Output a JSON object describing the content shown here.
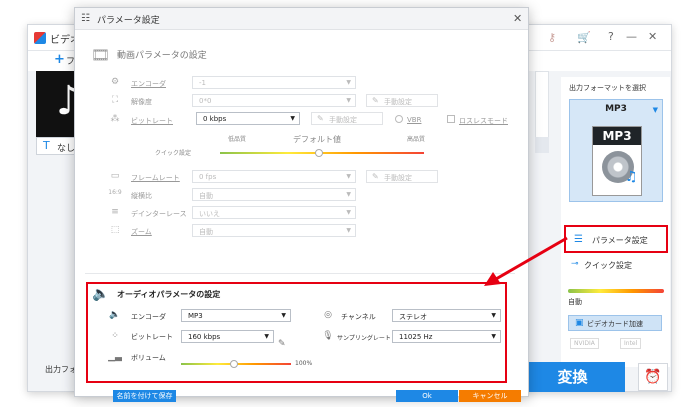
{
  "app": {
    "title": "ビデオ",
    "add_label": "フ",
    "subtitle_label": "なし",
    "output_folder_label": "出力フォル"
  },
  "right_panel": {
    "title": "出力フォーマットを選択",
    "format_name": "MP3",
    "format_badge": "MP3",
    "param_label": "パラメータ設定",
    "quick_label": "クイック設定",
    "auto_label": "自動",
    "gpu_label": "ビデオカード加速",
    "vendors": [
      "NVIDIA",
      "Intel"
    ],
    "convert_label": "変換"
  },
  "dialog": {
    "title": "パラメータ設定",
    "video_section_title": "動画パラメータの設定",
    "video": {
      "encoder_label": "エンコーダ",
      "encoder_value": "-1",
      "resolution_label": "解像度",
      "resolution_value": "0*0",
      "manual_label": "手動設定",
      "bitrate_label": "ビットレート",
      "bitrate_value": "0 kbps",
      "vbr_label": "VBR",
      "lossless_label": "ロスレスモード",
      "quick_setting_label": "クイック設定",
      "low_quality": "低品質",
      "default_value": "デフォルト値",
      "high_quality": "高品質",
      "framerate_label": "フレームレート",
      "framerate_value": "0 fps",
      "aspect_label": "縦横比",
      "aspect_value": "自動",
      "deinterlace_label": "デインターレース",
      "deinterlace_value": "いいえ",
      "zoom_label": "ズーム",
      "zoom_value": "自動"
    },
    "audio_section_title": "オーディオパラメータの設定",
    "audio": {
      "encoder_label": "エンコーダ",
      "encoder_value": "MP3",
      "bitrate_label": "ビットレート",
      "bitrate_value": "160 kbps",
      "volume_label": "ボリューム",
      "volume_percent": "100%",
      "volume_level": 0.45,
      "channel_label": "チャンネル",
      "channel_value": "ステレオ",
      "samplerate_label": "サンプリングレート",
      "samplerate_value": "11025 Hz"
    },
    "save_as_label": "名前を付けて保存",
    "ok_label": "Ok",
    "cancel_label": "キャンセル"
  },
  "colors": {
    "accent": "#1e88e5",
    "highlight": "#e60012",
    "cancel": "#f57c00"
  }
}
